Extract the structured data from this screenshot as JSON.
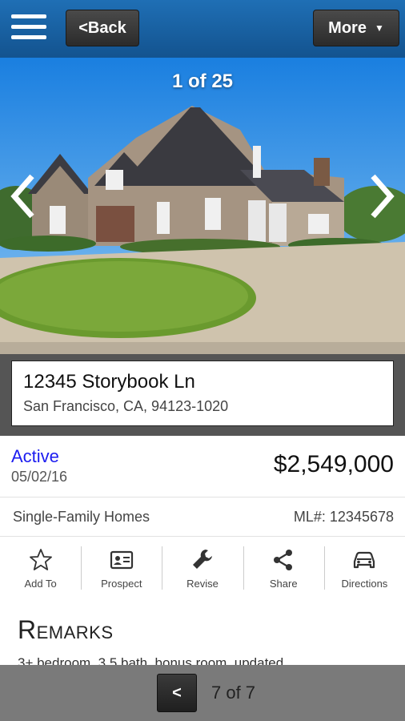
{
  "header": {
    "back_label": "<Back",
    "more_label": "More",
    "more_caret": "▼"
  },
  "photo": {
    "counter": "1 of 25"
  },
  "listing": {
    "street": "12345 Storybook Ln",
    "city_line": "San Francisco, CA, 94123-1020",
    "status": "Active",
    "date": "05/02/16",
    "price": "$2,549,000",
    "property_type": "Single-Family Homes",
    "mls": "ML#: 12345678",
    "status_color": "#1c1cf0"
  },
  "actions": [
    {
      "label": "Add To",
      "icon": "star-icon"
    },
    {
      "label": "Prospect",
      "icon": "contact-card-icon"
    },
    {
      "label": "Revise",
      "icon": "wrench-icon"
    },
    {
      "label": "Share",
      "icon": "share-icon"
    },
    {
      "label": "Directions",
      "icon": "car-icon"
    }
  ],
  "remarks": {
    "title": "Remarks",
    "text": "3+ bedroom, 3.5 bath, bonus room, updated..."
  },
  "pager": {
    "prev_label": "<",
    "position": "7 of 7"
  },
  "colors": {
    "header_blue": "#1f6fb5",
    "bottom_bar": "#7a7a7a"
  }
}
